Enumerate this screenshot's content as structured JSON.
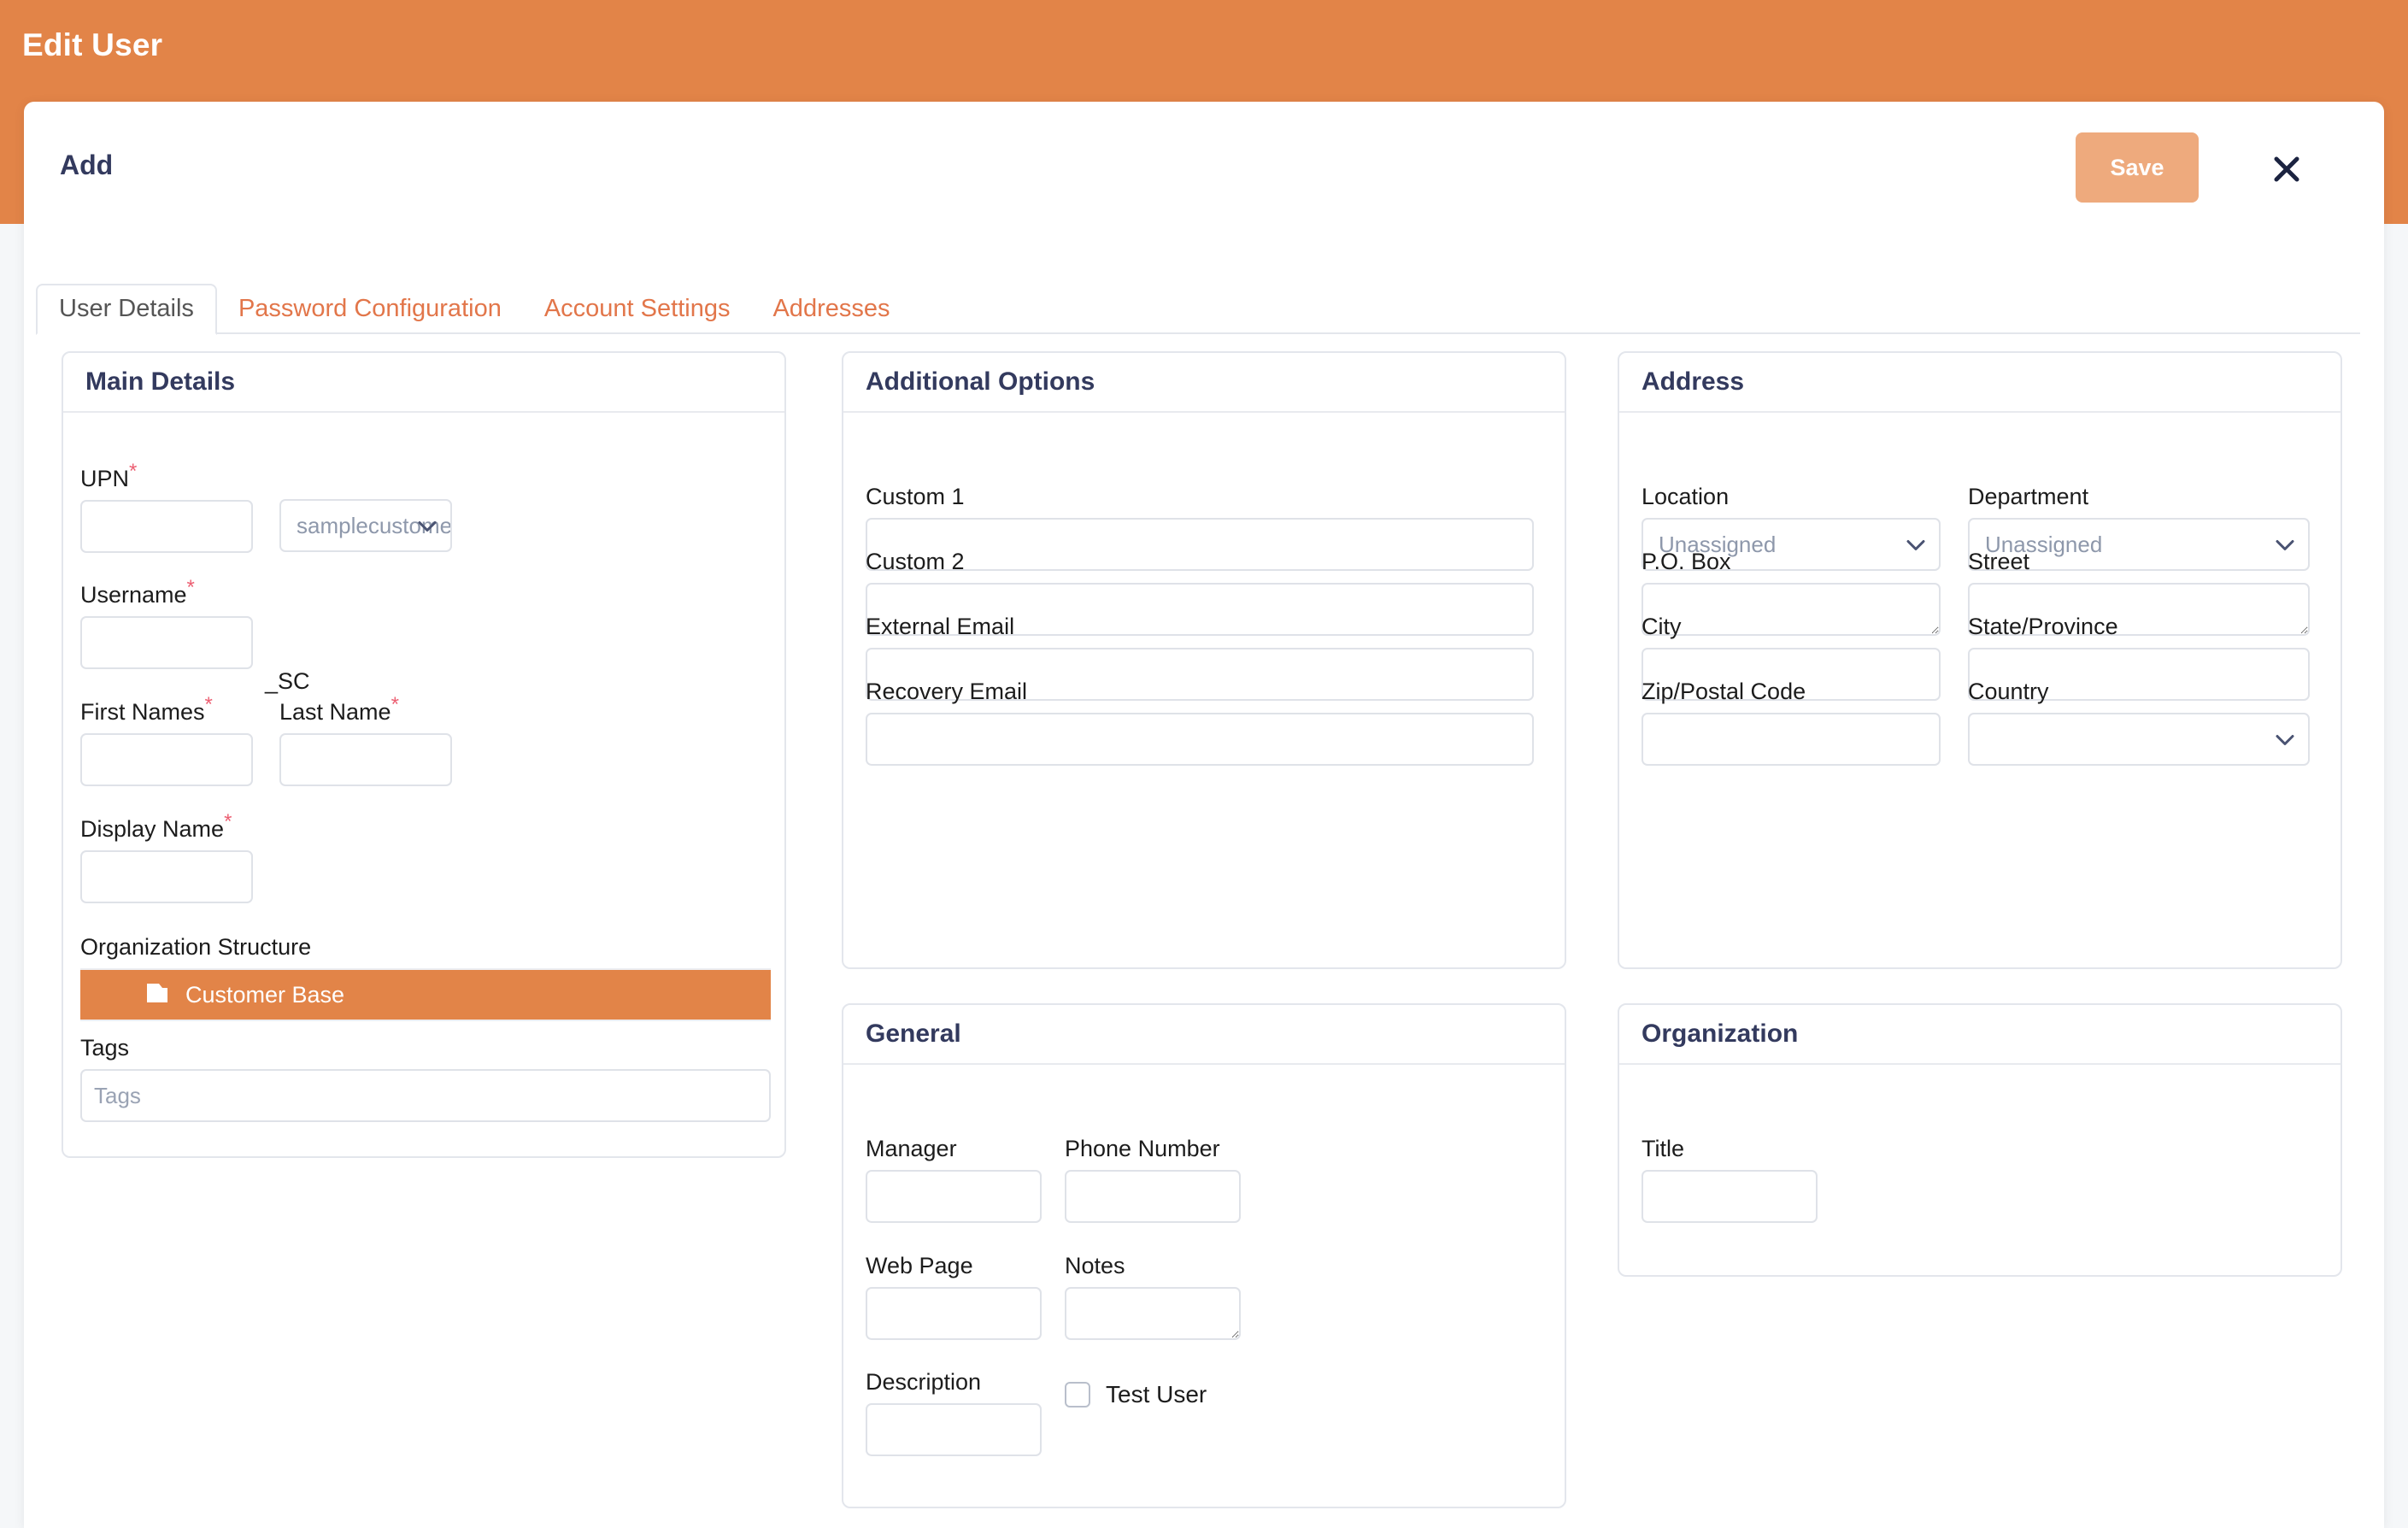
{
  "app": {
    "title": "Edit User",
    "accent_color": "#e28448",
    "heading_color": "#333a5e",
    "required_marker": "*"
  },
  "modal": {
    "title": "Add",
    "save_label": "Save",
    "close_icon": "close-icon"
  },
  "tabs": [
    {
      "label": "User Details",
      "active": true
    },
    {
      "label": "Password Configuration",
      "active": false
    },
    {
      "label": "Account Settings",
      "active": false
    },
    {
      "label": "Addresses",
      "active": false
    }
  ],
  "main_details": {
    "title": "Main Details",
    "upn": {
      "label": "UPN",
      "required": true,
      "value": "",
      "placeholder": ""
    },
    "domain": {
      "value": "samplecustomer.c…",
      "icon": "chevron-down-icon"
    },
    "username": {
      "label": "Username",
      "required": true,
      "value": "",
      "placeholder": ""
    },
    "sc_label": "_SC",
    "first_names": {
      "label": "First Names",
      "required": true,
      "value": "",
      "placeholder": ""
    },
    "last_name": {
      "label": "Last Name",
      "required": true,
      "value": "",
      "placeholder": ""
    },
    "display_name": {
      "label": "Display Name",
      "required": true,
      "value": "",
      "placeholder": ""
    },
    "organization_structure": {
      "label": "Organization Structure",
      "selected_node": "Customer Base",
      "node_icon": "folder-icon"
    },
    "tags": {
      "label": "Tags",
      "value": "",
      "placeholder": "Tags"
    }
  },
  "additional_options": {
    "title": "Additional Options",
    "custom_1": {
      "label": "Custom 1",
      "value": "",
      "placeholder": ""
    },
    "custom_2": {
      "label": "Custom 2",
      "value": "",
      "placeholder": ""
    },
    "external_email": {
      "label": "External Email",
      "value": "",
      "placeholder": ""
    },
    "recovery_email": {
      "label": "Recovery Email",
      "value": "",
      "placeholder": ""
    }
  },
  "address": {
    "title": "Address",
    "location": {
      "label": "Location",
      "value": "Unassigned",
      "icon": "chevron-down-icon"
    },
    "department": {
      "label": "Department",
      "value": "Unassigned",
      "icon": "chevron-down-icon"
    },
    "po_box": {
      "label": "P.O. Box",
      "value": "",
      "placeholder": ""
    },
    "street": {
      "label": "Street",
      "value": "",
      "placeholder": ""
    },
    "city": {
      "label": "City",
      "value": "",
      "placeholder": ""
    },
    "state_province": {
      "label": "State/Province",
      "value": "",
      "placeholder": ""
    },
    "zip_postal_code": {
      "label": "Zip/Postal Code",
      "value": "",
      "placeholder": ""
    },
    "country": {
      "label": "Country",
      "value": "",
      "icon": "chevron-down-icon"
    }
  },
  "general": {
    "title": "General",
    "manager": {
      "label": "Manager",
      "value": "",
      "placeholder": ""
    },
    "phone_number": {
      "label": "Phone Number",
      "value": "",
      "placeholder": ""
    },
    "web_page": {
      "label": "Web Page",
      "value": "",
      "placeholder": ""
    },
    "notes": {
      "label": "Notes",
      "value": "",
      "placeholder": ""
    },
    "description": {
      "label": "Description",
      "value": "",
      "placeholder": ""
    },
    "test_user": {
      "label": "Test User",
      "checked": false
    }
  },
  "organization": {
    "title": "Organization",
    "title_field": {
      "label": "Title",
      "value": "",
      "placeholder": ""
    }
  }
}
